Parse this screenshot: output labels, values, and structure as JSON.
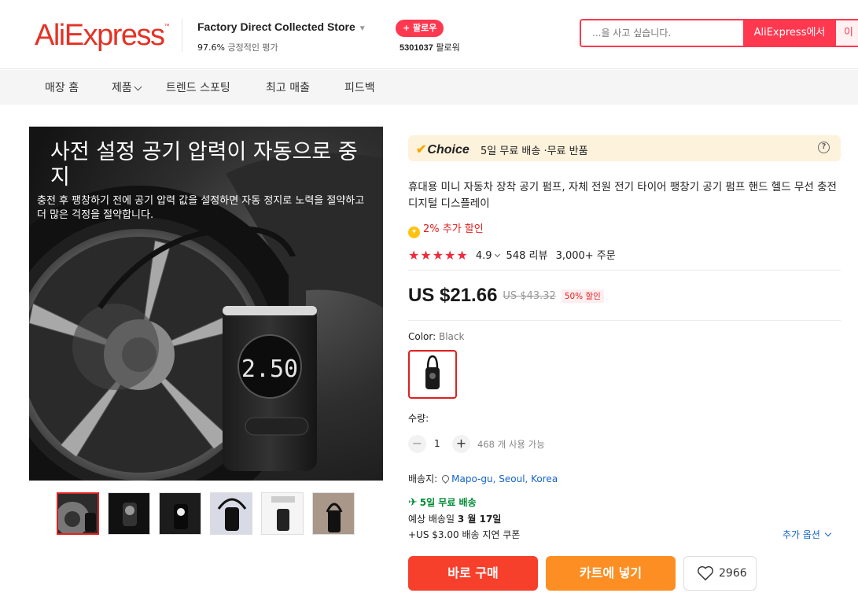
{
  "header": {
    "logo": "AliExpress",
    "logo_tm": "™",
    "store_name": "Factory Direct Collected Store",
    "rating_pct": "97.6%",
    "rating_text": "긍정적인 평가",
    "follow_label": "+ 팔로우",
    "followers_count": "5301037",
    "followers_label": "팔로워",
    "search_placeholder": "...을 사고 싶습니다.",
    "search_button": "AliExpress에서",
    "search_button2": "이"
  },
  "nav": {
    "items": [
      "매장 홈",
      "제품",
      "트렌드 스포팅",
      "최고 매출",
      "피드백"
    ]
  },
  "hero": {
    "title": "사전 설정 공기 압력이 자동으로 중지",
    "subtitle": "충전 후 팽창하기 전에 공기 압력 값을 설정하면 자동 정지로 노력을 절약하고 더 많은 걱정을 절약합니다.",
    "display_value": "2.50"
  },
  "product": {
    "choice_label": "Choice",
    "choice_text": "5일 무료 배송 ·무료 반품",
    "help_icon": "?",
    "title": "휴대용 미니 자동차 장착 공기 펌프, 자체 전원 전기 타이어 팽창기 공기 펌프 핸드 헬드 무선 충전 디지털 디스플레이",
    "extra_discount": "2% 추가 할인",
    "stars": "★★★★★",
    "rating": "4.9",
    "reviews": "548 리뷰",
    "orders": "3,000+ 주문",
    "price": "US $21.66",
    "old_price": "US $43.32",
    "discount_badge": "50% 할인",
    "color_label": "Color: ",
    "color_value": "Black",
    "qty_label": "수량:",
    "qty_minus": "−",
    "qty_value": "1",
    "qty_plus": "+",
    "qty_available": "468 개 사용 가능",
    "ship_to_label": "배송지:",
    "ship_to_location": "Mapo-gu, Seoul, Korea",
    "fast_ship": "5일 무료 배송",
    "est_prefix": "예상 배송일",
    "est_date": "3 월 17일",
    "coupon": "+US $3.00 배송 지연 쿠폰",
    "more_options": "추가 옵션",
    "buy_now": "바로 구매",
    "add_to_cart": "카트에 넣기",
    "wishlist_count": "2966"
  },
  "colors": {
    "brand_red": "#e43225",
    "accent": "#fd384f",
    "buy": "#f6402c",
    "cart": "#fc8e23",
    "ship_green": "#018a36",
    "link_blue": "#1464c8"
  }
}
